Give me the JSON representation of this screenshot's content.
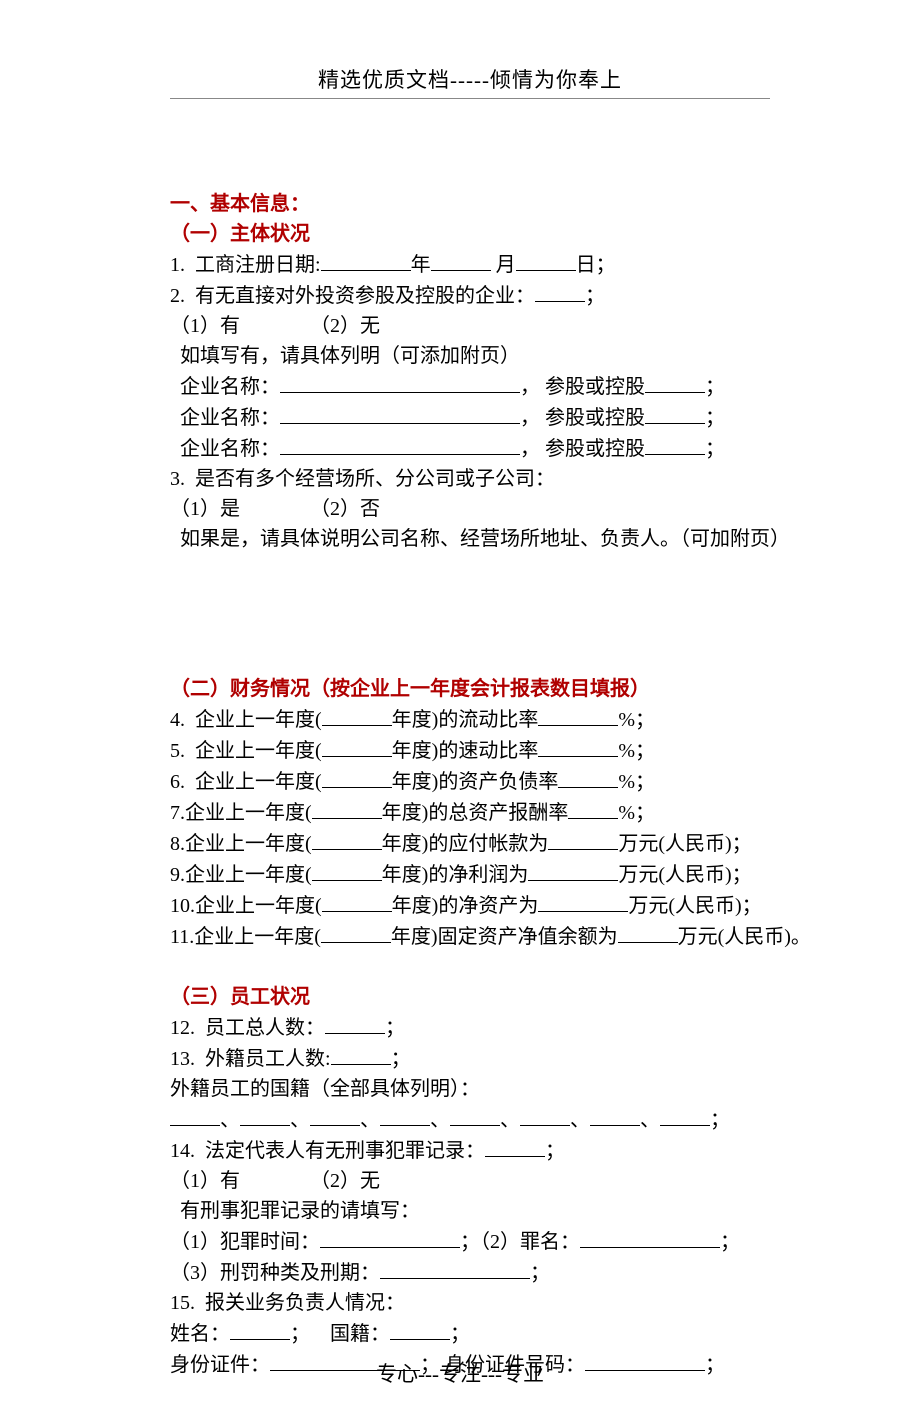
{
  "header": "精选优质文档-----倾情为你奉上",
  "footer": "专心---专注---专业",
  "s1": {
    "title": "一、基本信息：",
    "sub1": {
      "title": "（一）主体状况",
      "q1_prefix": "1.  工商注册日期:",
      "q1_year": "年",
      "q1_month": " 月",
      "q1_day": "日；",
      "q2": "2.  有无直接对外投资参股及控股的企业：",
      "q2_tail": "；",
      "opt_yes": "（1）有",
      "opt_no": "（2）无",
      "q2_note": "  如填写有，请具体列明（可添加附页）",
      "ent_label": "  企业名称：",
      "ent_mid": "， 参股或控股",
      "ent_tail": "；",
      "q3": "3.  是否有多个经营场所、分公司或子公司：",
      "q3_yes": "（1）是",
      "q3_no": "（2）否",
      "q3_note": "  如果是，请具体说明公司名称、经营场所地址、负责人。（可加附页）"
    },
    "sub2": {
      "title": "（二）财务情况（按企业上一年度会计报表数目填报）",
      "q4_a": "4.  企业上一年度(",
      "q4_b": "年度)的流动比率",
      "pct": "%；",
      "q5_a": "5.  企业上一年度(",
      "q5_b": "年度)的速动比率",
      "q6_a": "6.  企业上一年度(",
      "q6_b": "年度)的资产负债率",
      "q7_a": "7.企业上一年度(",
      "q7_b": "年度)的总资产报酬率",
      "q8_a": "8.企业上一年度(",
      "q8_b": "年度)的应付帐款为",
      "wan": "万元(人民币)；",
      "q9_a": "9.企业上一年度(",
      "q9_b": "年度)的净利润为",
      "q10_a": "10.企业上一年度(",
      "q10_b": "年度)的净资产为",
      "q11_a": "11.企业上一年度(",
      "q11_b": "年度)固定资产净值余额为",
      "q11_tail": "万元(人民币)。"
    },
    "sub3": {
      "title": "（三）员工状况",
      "q12": "12.  员工总人数：",
      "semi": "；",
      "q13": "13.  外籍员工人数:",
      "q13_note": "外籍员工的国籍（全部具体列明）：",
      "sep": "、",
      "q14": "14.  法定代表人有无刑事犯罪记录：",
      "q14_yes": "（1）有",
      "q14_no": "（2）无",
      "q14_note": "  有刑事犯罪记录的请填写：",
      "q14_1": "（1）犯罪时间：",
      "q14_2": "；（2）罪名：",
      "q14_2_tail": "；",
      "q14_3": "（3）刑罚种类及刑期：",
      "q15": "15.  报关业务负责人情况：",
      "q15_name": "姓名：",
      "q15_nat": "；    国籍：",
      "q15_id": "身份证件：",
      "q15_idnum": "； 身份证件号码：",
      "q15_tail": "；"
    }
  }
}
